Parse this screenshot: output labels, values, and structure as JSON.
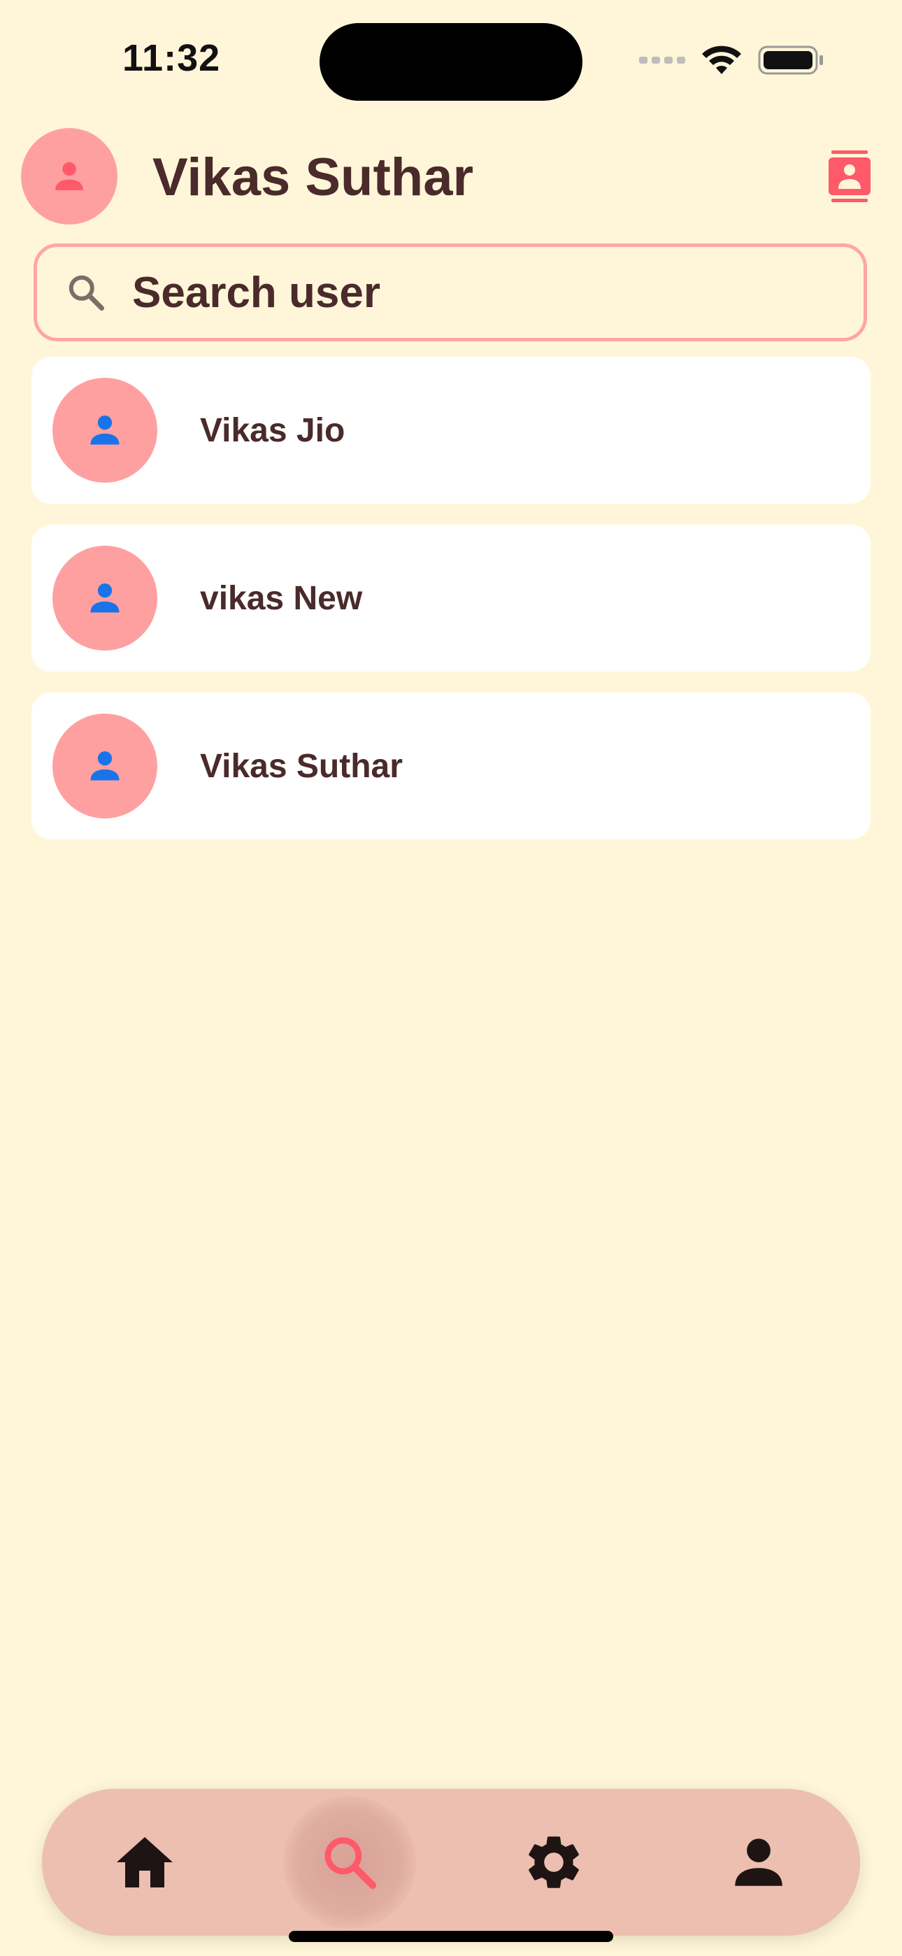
{
  "status_bar": {
    "time": "11:32"
  },
  "header": {
    "title": "Vikas Suthar",
    "avatar_icon": "person-icon",
    "action_icon": "contacts-icon"
  },
  "search": {
    "placeholder": "Search user",
    "value": "",
    "icon": "search-icon"
  },
  "users": [
    {
      "name": "Vikas Jio"
    },
    {
      "name": "vikas New"
    },
    {
      "name": "Vikas Suthar"
    }
  ],
  "bottom_nav": {
    "items": [
      {
        "icon": "home-icon",
        "active": false
      },
      {
        "icon": "search-icon",
        "active": true
      },
      {
        "icon": "settings-icon",
        "active": false
      },
      {
        "icon": "person-icon",
        "active": false
      }
    ]
  },
  "colors": {
    "background": "#FFF6D9",
    "accent_pink": "#FF5A6A",
    "avatar_bg": "#FFA0A0",
    "text_dark": "#4A2A2A",
    "list_icon_blue": "#1A73E8",
    "nav_bg": "#ECBFB0"
  }
}
